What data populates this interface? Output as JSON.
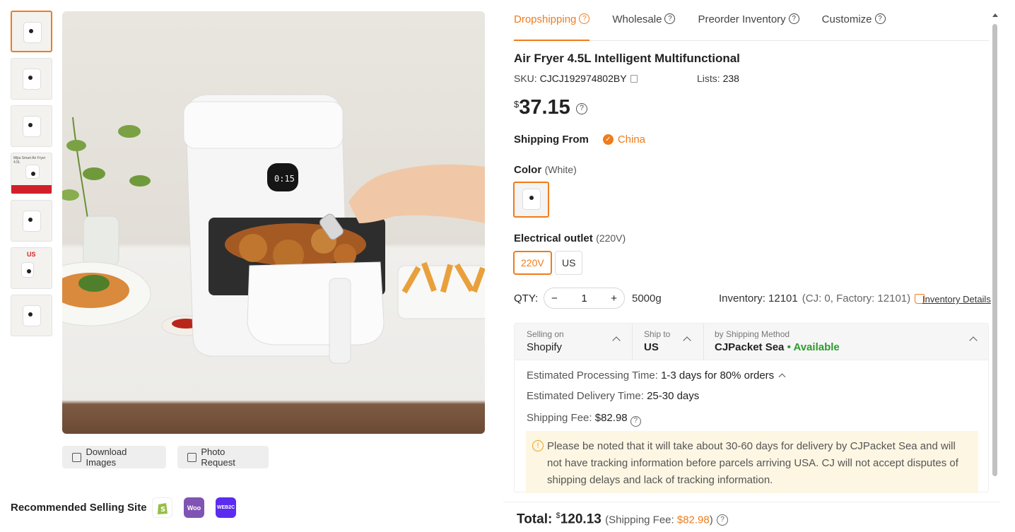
{
  "thumbnails": [
    "product-photo-1",
    "product-photo-2",
    "product-photo-3",
    "product-photo-4",
    "product-photo-5",
    "product-photo-6",
    "product-photo-7"
  ],
  "thumb4_caption": "Mijia Smart Air Fryer 4.5L",
  "thumb6_badge": "US",
  "gallery": {
    "download_label": "Download Images",
    "photo_request_label": "Photo Request"
  },
  "recommended": {
    "label": "Recommended Selling Site",
    "sites": [
      {
        "name": "shopify-icon",
        "color": "#95bf47",
        "text": ""
      },
      {
        "name": "woocommerce-icon",
        "color": "#7f54b3",
        "text": "Woo"
      },
      {
        "name": "webtoc-icon",
        "color": "#5b2cf0",
        "text": "WEB2C"
      }
    ]
  },
  "tabs": [
    "Dropshipping",
    "Wholesale",
    "Preorder Inventory",
    "Customize"
  ],
  "product": {
    "title": "Air Fryer 4.5L Intelligent Multifunctional",
    "sku_label": "SKU:",
    "sku": "CJCJ192974802BY",
    "lists_label": "Lists:",
    "lists": "238",
    "currency": "$",
    "price": "37.15"
  },
  "shipping_from": {
    "label": "Shipping From",
    "value": "China"
  },
  "color": {
    "label": "Color",
    "value": "(White)"
  },
  "outlet": {
    "label": "Electrical outlet",
    "value": "(220V)",
    "options": [
      "220V",
      "US"
    ]
  },
  "qty": {
    "label": "QTY:",
    "value": "1",
    "minus": "−",
    "plus": "+",
    "weight": "5000g"
  },
  "inventory": {
    "text": "Inventory: 12101",
    "detail": "(CJ: 0, Factory: 12101)",
    "link": "Inventory Details"
  },
  "shipping": {
    "selling_on_label": "Selling on",
    "selling_on": "Shopify",
    "ship_to_label": "Ship to",
    "ship_to": "US",
    "method_label": "by Shipping Method",
    "method": "CJPacket Sea",
    "availability": "• Available",
    "processing_label": "Estimated Processing Time:",
    "processing": "1-3 days for 80% orders",
    "delivery_label": "Estimated Delivery Time:",
    "delivery": "25-30 days",
    "fee_label": "Shipping Fee:",
    "fee": "$82.98",
    "notice": "Please be noted that it will take about 30-60 days for delivery by CJPacket Sea and will not have tracking information before parcels arriving USA. CJ will not accept disputes of shipping delays and lack of tracking information."
  },
  "total": {
    "label": "Total:",
    "currency": "$",
    "amount": "120.13",
    "fee_prefix": "(Shipping Fee: ",
    "fee": "$82.98",
    "fee_suffix": ")"
  },
  "colors": {
    "accent": "#f07c1b",
    "available": "#2e9b2e"
  }
}
